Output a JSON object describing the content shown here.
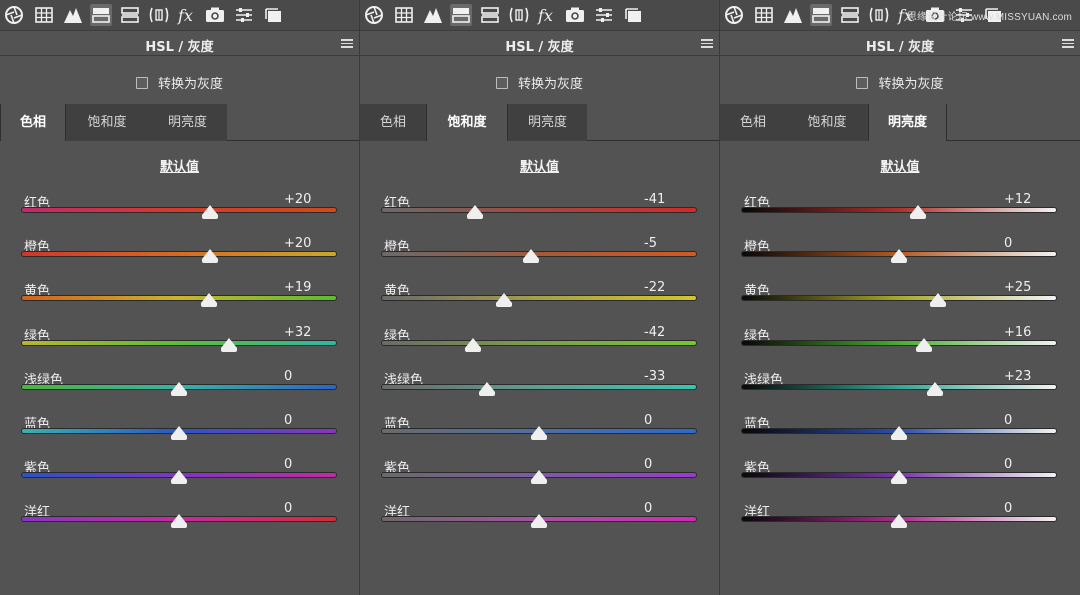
{
  "watermark": "思缘设计论坛 www.MISSYUAN.com",
  "toolbar_icons": [
    "aperture-icon",
    "grid-icon",
    "mountain-icon",
    "hsl-panel-icon",
    "split-tone-icon",
    "detail-icon",
    "fx-icon",
    "camera-icon",
    "sliders-icon",
    "presets-icon"
  ],
  "panels": [
    {
      "title": "HSL / 灰度",
      "checkbox_label": "转换为灰度",
      "tabs": [
        "色相",
        "饱和度",
        "明亮度"
      ],
      "active_tab": 0,
      "default_label": "默认值",
      "sliders": [
        {
          "label": "红色",
          "value": "+20",
          "num": 20,
          "gradient": [
            "#c3286a",
            "#d63b2a",
            "#cf4a1c"
          ]
        },
        {
          "label": "橙色",
          "value": "+20",
          "num": 20,
          "gradient": [
            "#d0362b",
            "#d76b22",
            "#c8a92a"
          ]
        },
        {
          "label": "黄色",
          "value": "+19",
          "num": 19,
          "gradient": [
            "#d3611f",
            "#c9b52b",
            "#5bbd30"
          ]
        },
        {
          "label": "绿色",
          "value": "+32",
          "num": 32,
          "gradient": [
            "#b8b62c",
            "#5dbd35",
            "#2fb7a3"
          ]
        },
        {
          "label": "浅绿色",
          "value": "0",
          "num": 0,
          "gradient": [
            "#48b73a",
            "#35b3a4",
            "#2b64c8"
          ]
        },
        {
          "label": "蓝色",
          "value": "0",
          "num": 0,
          "gradient": [
            "#35b3b0",
            "#2b56c7",
            "#8a33c3"
          ]
        },
        {
          "label": "紫色",
          "value": "0",
          "num": 0,
          "gradient": [
            "#2b52c8",
            "#7f35c4",
            "#c22aa5"
          ]
        },
        {
          "label": "洋红",
          "value": "0",
          "num": 0,
          "gradient": [
            "#8a34c4",
            "#c72aa0",
            "#d32c35"
          ]
        }
      ]
    },
    {
      "title": "HSL / 灰度",
      "checkbox_label": "转换为灰度",
      "tabs": [
        "色相",
        "饱和度",
        "明亮度"
      ],
      "active_tab": 1,
      "default_label": "默认值",
      "sliders": [
        {
          "label": "红色",
          "value": "-41",
          "num": -41,
          "gradient": [
            "#6a6a6a",
            "#a4493e",
            "#d4292a"
          ]
        },
        {
          "label": "橙色",
          "value": "-5",
          "num": -5,
          "gradient": [
            "#6a6a6a",
            "#a35a3a",
            "#d45a22"
          ]
        },
        {
          "label": "黄色",
          "value": "-22",
          "num": -22,
          "gradient": [
            "#6a6a6a",
            "#a6a048",
            "#d4c62a"
          ]
        },
        {
          "label": "绿色",
          "value": "-42",
          "num": -42,
          "gradient": [
            "#6a6a6a",
            "#7da04a",
            "#77c72f"
          ]
        },
        {
          "label": "浅绿色",
          "value": "-33",
          "num": -33,
          "gradient": [
            "#6a6a6a",
            "#5e9f92",
            "#34c7b0"
          ]
        },
        {
          "label": "蓝色",
          "value": "0",
          "num": 0,
          "gradient": [
            "#6a6a6a",
            "#4d6ea5",
            "#2a6ad0"
          ]
        },
        {
          "label": "紫色",
          "value": "0",
          "num": 0,
          "gradient": [
            "#6a6a6a",
            "#7d5aa5",
            "#9a3ad0"
          ]
        },
        {
          "label": "洋红",
          "value": "0",
          "num": 0,
          "gradient": [
            "#6a6a6a",
            "#a552a0",
            "#d22ab8"
          ]
        }
      ]
    },
    {
      "title": "HSL / 灰度",
      "checkbox_label": "转换为灰度",
      "tabs": [
        "色相",
        "饱和度",
        "明亮度"
      ],
      "active_tab": 2,
      "default_label": "默认值",
      "sliders": [
        {
          "label": "红色",
          "value": "+12",
          "num": 12,
          "gradient": [
            "#080808",
            "#b0302a",
            "#f2f2f2"
          ]
        },
        {
          "label": "橙色",
          "value": "0",
          "num": 0,
          "gradient": [
            "#080808",
            "#b55a22",
            "#f2f2f2"
          ]
        },
        {
          "label": "黄色",
          "value": "+25",
          "num": 25,
          "gradient": [
            "#080808",
            "#a9a82a",
            "#f2f2f2"
          ]
        },
        {
          "label": "绿色",
          "value": "+16",
          "num": 16,
          "gradient": [
            "#080808",
            "#48ad2e",
            "#f2f2f2"
          ]
        },
        {
          "label": "浅绿色",
          "value": "+23",
          "num": 23,
          "gradient": [
            "#080808",
            "#2ea895",
            "#f2f2f2"
          ]
        },
        {
          "label": "蓝色",
          "value": "0",
          "num": 0,
          "gradient": [
            "#080808",
            "#2b4fb0",
            "#f2f2f2"
          ]
        },
        {
          "label": "紫色",
          "value": "0",
          "num": 0,
          "gradient": [
            "#080808",
            "#7b35b0",
            "#f2f2f2"
          ]
        },
        {
          "label": "洋红",
          "value": "0",
          "num": 0,
          "gradient": [
            "#080808",
            "#b02a8e",
            "#f2f2f2"
          ]
        }
      ]
    }
  ]
}
